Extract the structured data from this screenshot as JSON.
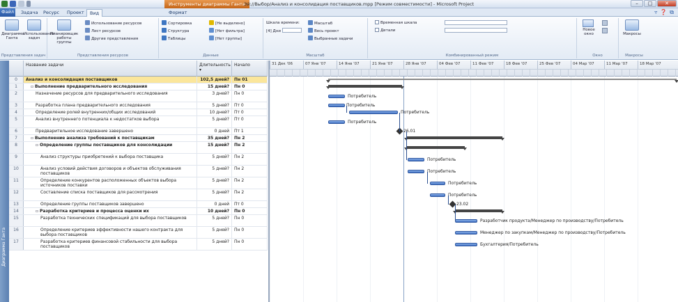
{
  "titlebar": {
    "context_tab": "Инструменты диаграммы Ганта",
    "title": "Эй://Выбор/Анализ и консолидация поставщиков.mpp [Режим совместимости] - Microsoft Project",
    "min": "–",
    "max": "□",
    "close": "✕"
  },
  "tabs": {
    "file": "Файл",
    "items": [
      "Задача",
      "Ресурс",
      "Проект",
      "Вид"
    ],
    "format": "Формат",
    "active_index": 3
  },
  "ribbon": {
    "task_views": {
      "gantt": "Диаграмма Ганта",
      "usage": "Использование задач",
      "label": "Представления задач"
    },
    "resource_views": {
      "planner": "Планировщик работы группы",
      "res_usage": "Использование ресурсов",
      "res_sheet": "Лист ресурсов",
      "other": "Другие представления",
      "label": "Представления ресурсов"
    },
    "data": {
      "sort": "Сортировка",
      "outline": "Структура",
      "tables": "Таблицы",
      "highlight": "[Не выделено]",
      "filter": "[Нет фильтра]",
      "group": "[Нет группы]",
      "label": "Данные"
    },
    "zoom": {
      "timescale": "Шкала времени:",
      "timescale_value": "[4] Дни",
      "scale": "Масштаб",
      "whole_project": "Весь проект",
      "selected_tasks": "Выбранные задачи",
      "label": "Масштаб"
    },
    "split_view": {
      "timeline": "Временная шкала",
      "details": "Детали",
      "label": "Комбинированный режим"
    },
    "window": {
      "new_window": "Новое окно",
      "label": "Окно"
    },
    "macros": {
      "macros": "Макросы",
      "label": "Макросы"
    }
  },
  "viewbar": {
    "label": "Диаграмма Ганта"
  },
  "table": {
    "headers": {
      "id": "",
      "name": "Название задачи",
      "duration": "Длительность",
      "start": "Начало"
    },
    "rows": [
      {
        "id": "0",
        "name": "Анализ и консолидация поставщиков",
        "duration": "102,5 дней?",
        "start": "Пн 01",
        "level": 0,
        "summary": true,
        "selected": true
      },
      {
        "id": "1",
        "name": "Выполнение предварительного исследования",
        "duration": "15 дней?",
        "start": "Пн 0",
        "level": 1,
        "summary": true
      },
      {
        "id": "2",
        "name": "Назначение ресурсов для предварительного исследования",
        "duration": "3 дней?",
        "start": "Пн 0",
        "level": 2
      },
      {
        "id": "3",
        "name": "Разработка плана предварительного исследования",
        "duration": "5 дней?",
        "start": "Пт 0",
        "level": 2
      },
      {
        "id": "4",
        "name": "Определение ролей внутренних/общих исследований",
        "duration": "10 дней?",
        "start": "Пт 0",
        "level": 2
      },
      {
        "id": "5",
        "name": "Анализ внутреннего потенциала к недостатков выбора",
        "duration": "5 дней?",
        "start": "Пт 0",
        "level": 2
      },
      {
        "id": "6",
        "name": "Предварительное исследование завершено",
        "duration": "0 дней",
        "start": "Пт 1",
        "level": 2
      },
      {
        "id": "7",
        "name": "Выполнение анализа требований к поставщикам",
        "duration": "35 дней?",
        "start": "Пн 2",
        "level": 1,
        "summary": true
      },
      {
        "id": "8",
        "name": "Определение группы поставщиков для консолидации",
        "duration": "15 дней?",
        "start": "Пн 2",
        "level": 2,
        "summary": true
      },
      {
        "id": "9",
        "name": "Анализ структуры приобретений к выбора поставщика",
        "duration": "5 дней?",
        "start": "Пн 2",
        "level": 3
      },
      {
        "id": "10",
        "name": "Анализ условий действия договоров и объектов обслуживания поставщиков",
        "duration": "5 дней?",
        "start": "Пн 2",
        "level": 3
      },
      {
        "id": "11",
        "name": "Определение конкурентов расположенных объектов выбора источников поставки",
        "duration": "5 дней?",
        "start": "Пн 2",
        "level": 3
      },
      {
        "id": "12",
        "name": "Составление списка поставщиков для рассмотрения",
        "duration": "5 дней?",
        "start": "Пн 2",
        "level": 3
      },
      {
        "id": "13",
        "name": "Определение группы поставщиков завершено",
        "duration": "0 дней",
        "start": "Пт 0",
        "level": 3
      },
      {
        "id": "14",
        "name": "Разработка критериев и процесса оценки их",
        "duration": "10 дней?",
        "start": "Пн 0",
        "level": 2,
        "summary": true
      },
      {
        "id": "15",
        "name": "Разработка технических спецификаций для выбора поставщиков",
        "duration": "5 дней?",
        "start": "Пн 0",
        "level": 3
      },
      {
        "id": "16",
        "name": "Определение критериев эффективности нашего контракта для выбора поставщиков",
        "duration": "5 дней?",
        "start": "Пн 0",
        "level": 3
      },
      {
        "id": "17",
        "name": "Разработка критериев финансовой стабильности для выбора поставщиков",
        "duration": "5 дней?",
        "start": "Пн 0",
        "level": 3
      }
    ]
  },
  "gantt": {
    "weeks": [
      "31 Дек '06",
      "07 Янв '07",
      "14 Янв '07",
      "21 Янв '07",
      "28 Янв '07",
      "04 Фев '07",
      "11 Фев '07",
      "18 Фев '07",
      "25 Фев '07",
      "04 Мар '07",
      "11 Мар '07",
      "18 Мар '07"
    ],
    "labels": {
      "r2": "Потребитель",
      "r3": "Потребитель",
      "r4": "Потребитель",
      "r5": "Потребитель",
      "r6": "26.01",
      "r9": "Потребитель",
      "r10": "Потребитель",
      "r11": "Потребитель",
      "r12": "Потребитель",
      "r13": "23.02",
      "r15": "Разработчик продукта/Менеджер по производству/Потребитель",
      "r16": "Менеджер по закупкам/Менеджер по производству/Потребитель",
      "r17": "Бухгалтерия/Потребитель"
    }
  }
}
